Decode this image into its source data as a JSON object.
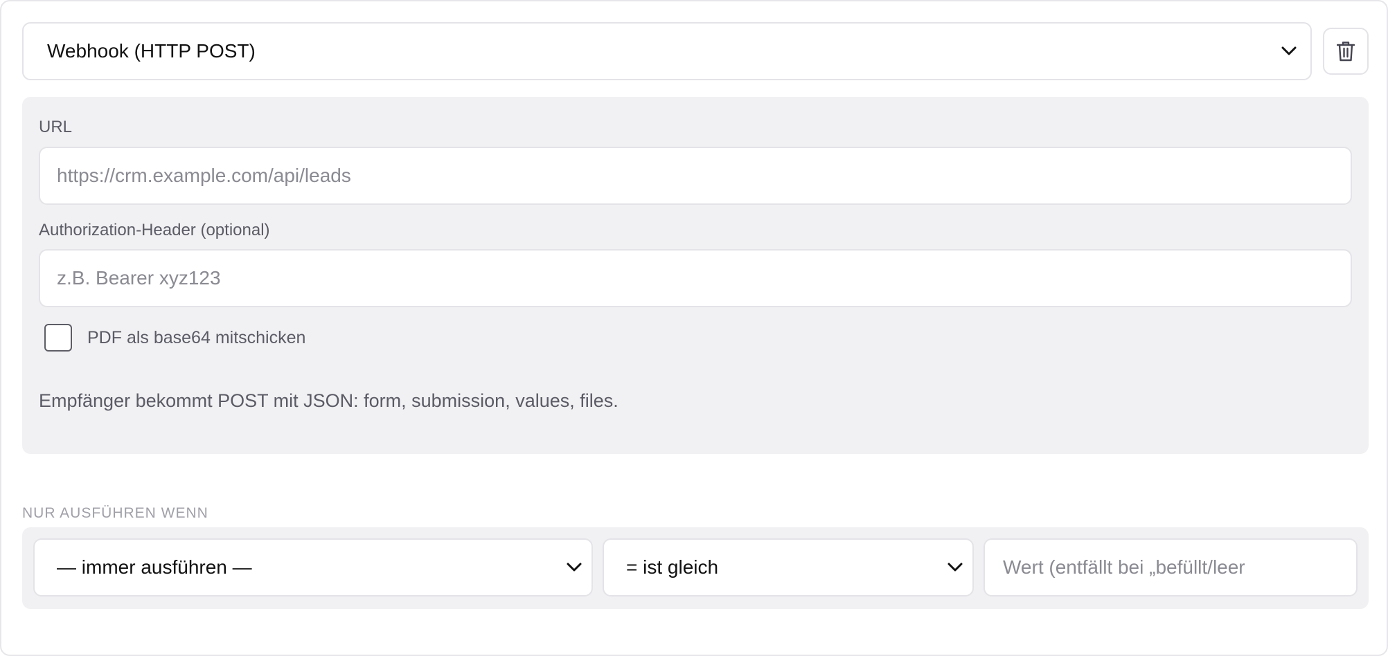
{
  "action": {
    "type_select": {
      "value": "Webhook (HTTP POST)"
    },
    "delete_icon": "trash-icon"
  },
  "webhook_config": {
    "url": {
      "label": "URL",
      "placeholder": "https://crm.example.com/api/leads"
    },
    "auth_header": {
      "label": "Authorization-Header (optional)",
      "placeholder": "z.B. Bearer xyz123"
    },
    "pdf_checkbox": {
      "label": "PDF als base64 mitschicken",
      "checked": false
    },
    "help_text": "Empfänger bekommt POST mit JSON: form, submission, values, files."
  },
  "condition": {
    "heading": "NUR AUSFÜHREN WENN",
    "field_select": {
      "value": "— immer ausführen —"
    },
    "operator_select": {
      "value": "= ist gleich"
    },
    "value_input": {
      "placeholder": "Wert (entfällt bei „befüllt/leer"
    }
  },
  "colors": {
    "panel_bg": "#f1f1f3",
    "border": "#e3e3e8",
    "label_text": "#5b5b66",
    "placeholder_text": "#8a8a92",
    "heading_text": "#a0a0a8"
  }
}
